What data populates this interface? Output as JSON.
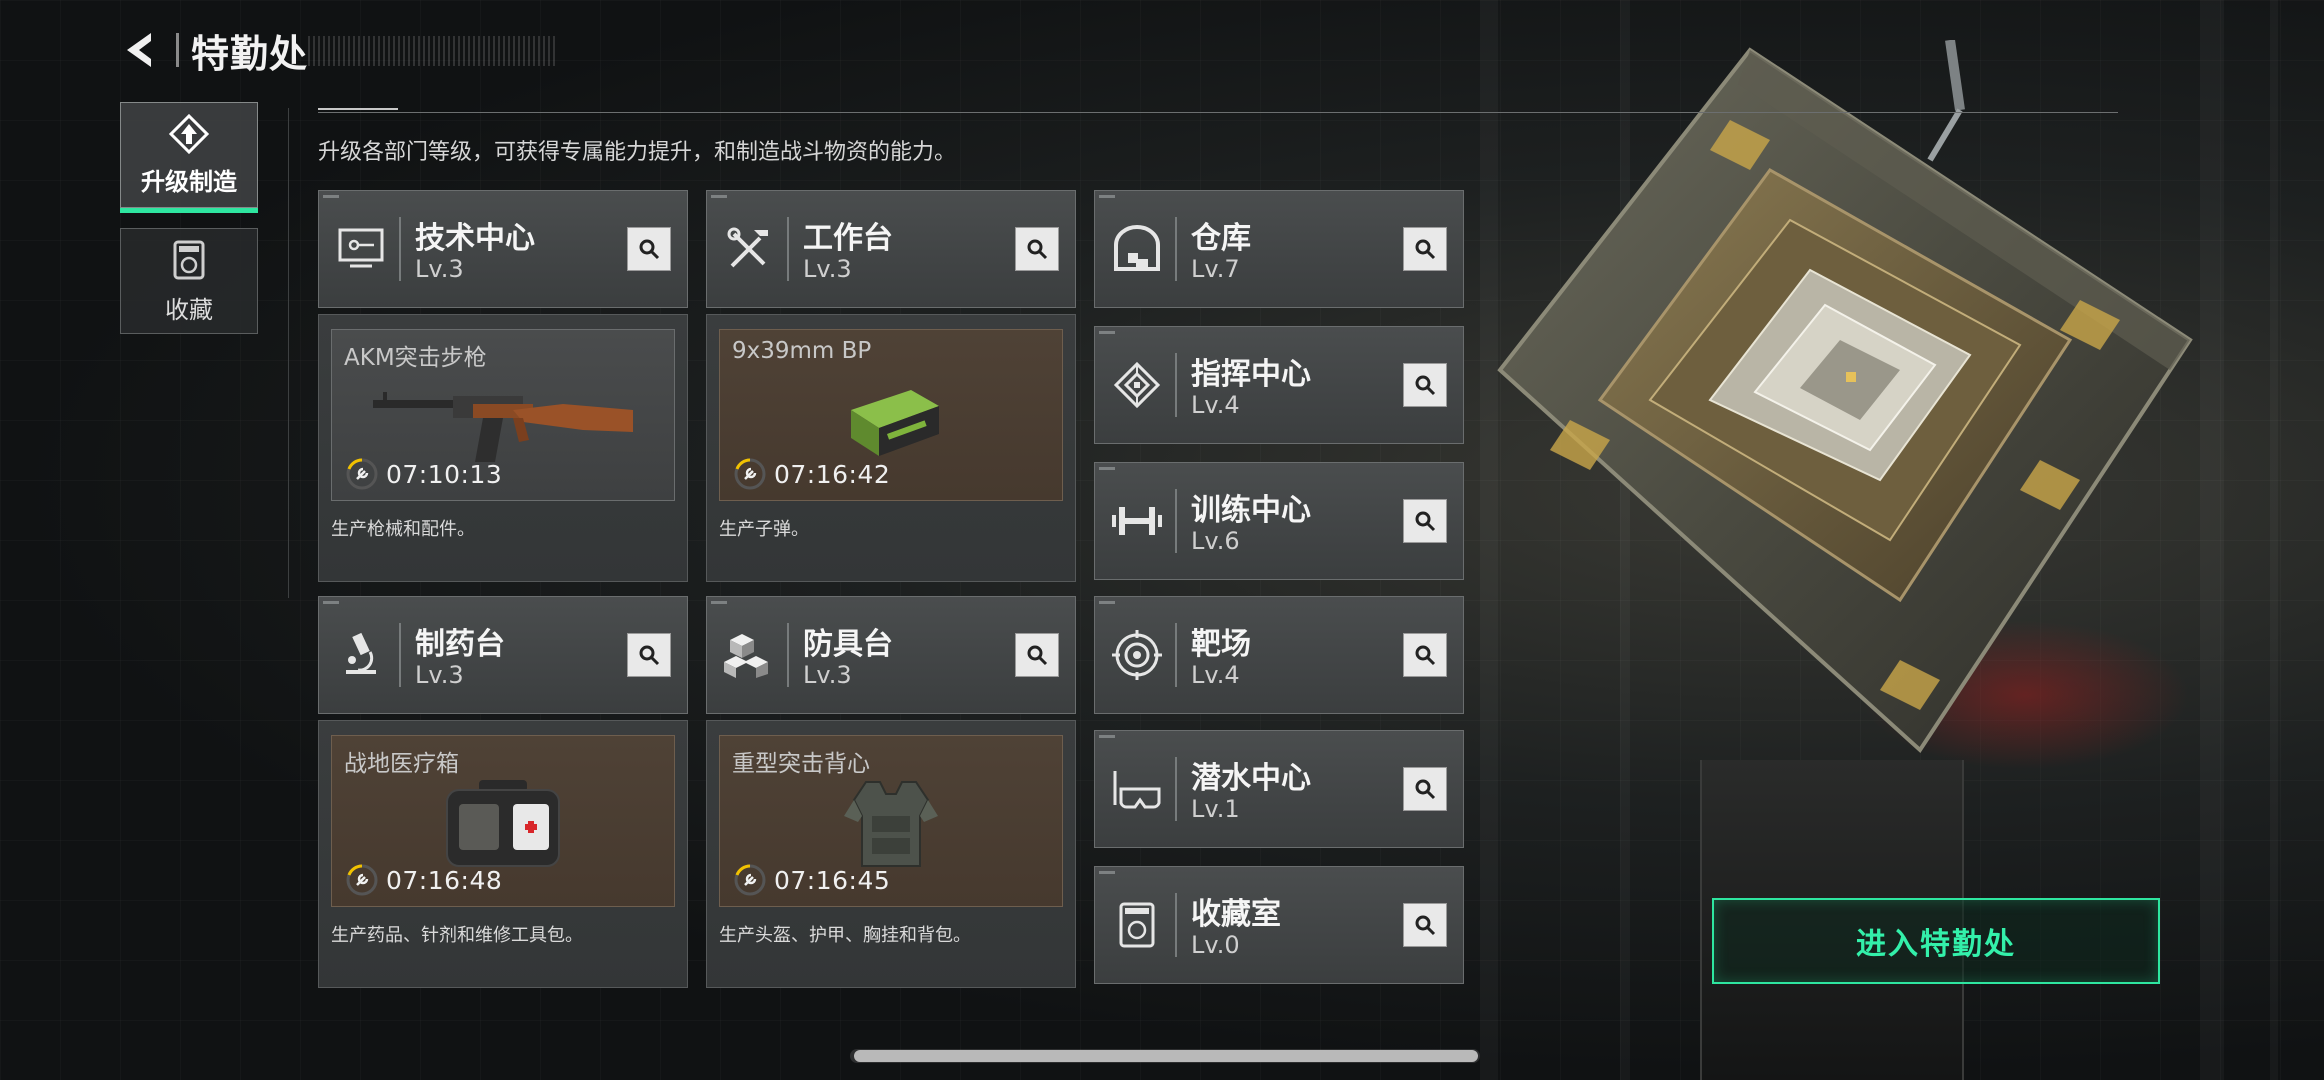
{
  "header": {
    "title": "特勤处"
  },
  "nav": [
    {
      "label": "升级制造",
      "icon": "upgrade-icon",
      "active": true
    },
    {
      "label": "收藏",
      "icon": "collection-icon",
      "active": false
    }
  ],
  "description": "升级各部门等级，可获得专属能力提升，和制造战斗物资的能力。",
  "production": [
    {
      "name": "技术中心",
      "level": "Lv.3",
      "icon": "monitor-icon",
      "item": "AKM突击步枪",
      "timer": "07:10:13",
      "desc": "生产枪械和配件。"
    },
    {
      "name": "工作台",
      "level": "Lv.3",
      "icon": "tools-icon",
      "item": "9x39mm BP",
      "timer": "07:16:42",
      "desc": "生产子弹。"
    },
    {
      "name": "制药台",
      "level": "Lv.3",
      "icon": "microscope-icon",
      "item": "战地医疗箱",
      "timer": "07:16:48",
      "desc": "生产药品、针剂和维修工具包。"
    },
    {
      "name": "防具台",
      "level": "Lv.3",
      "icon": "armor-cubes-icon",
      "item": "重型突击背心",
      "timer": "07:16:45",
      "desc": "生产头盔、护甲、胸挂和背包。"
    }
  ],
  "facilities": [
    {
      "name": "仓库",
      "level": "Lv.7",
      "icon": "warehouse-icon"
    },
    {
      "name": "指挥中心",
      "level": "Lv.4",
      "icon": "command-chip-icon"
    },
    {
      "name": "训练中心",
      "level": "Lv.6",
      "icon": "dumbbell-icon"
    },
    {
      "name": "靶场",
      "level": "Lv.4",
      "icon": "target-icon"
    },
    {
      "name": "潜水中心",
      "level": "Lv.1",
      "icon": "diving-mask-icon"
    },
    {
      "name": "收藏室",
      "level": "Lv.0",
      "icon": "collection-room-icon"
    }
  ],
  "enter_button": "进入特勤处",
  "colors": {
    "accent": "#2ee6a0"
  }
}
